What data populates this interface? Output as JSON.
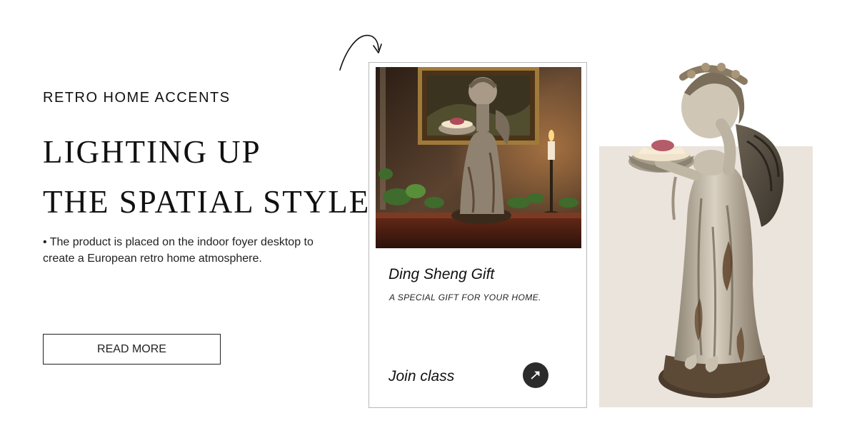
{
  "hero": {
    "eyebrow": "RETRO HOME ACCENTS",
    "headline_line1": "LIGHTING UP",
    "headline_line2": "THE SPATIAL STYLE",
    "description": "• The product is placed on the indoor foyer desktop to create a European retro home atmosphere.",
    "read_more_label": "READ MORE"
  },
  "card": {
    "brand": "Ding Sheng Gift",
    "tagline": "A SPECIAL GIFT FOR YOUR HOME.",
    "join_label": "Join class",
    "go_icon": "arrow-up-right-icon"
  },
  "icons": {
    "doodle": "curved-arrow-icon"
  },
  "colors": {
    "text": "#111111",
    "panel_beige": "#ebe4dc",
    "card_border": "#b9b9b9",
    "go_button": "#2b2b2b"
  }
}
